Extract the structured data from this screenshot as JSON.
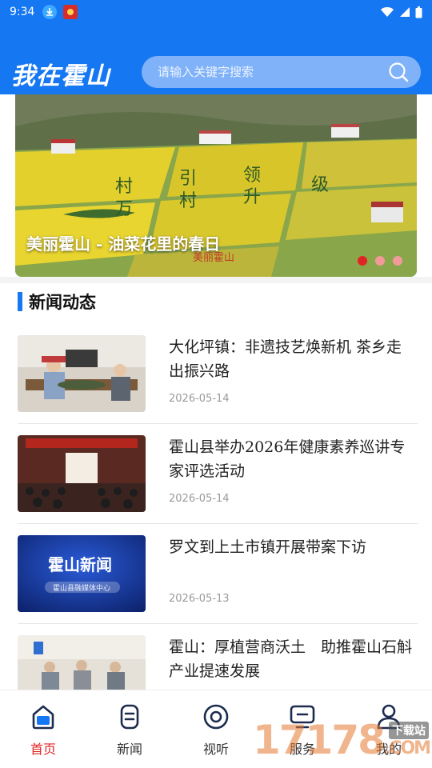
{
  "status_bar": {
    "time": "9:34",
    "icons": [
      "download-icon",
      "app-badge-icon",
      "wifi-icon",
      "signal-icon",
      "battery-icon"
    ]
  },
  "header": {
    "brand": "我在霍山",
    "search_placeholder": "请输入关键字搜索",
    "bg_color": "#1677f2"
  },
  "banner": {
    "caption": "美丽霍山 - 油菜花里的春日",
    "dots": 3,
    "active_dot": 0,
    "field_text": [
      "村",
      "引",
      "领",
      "村",
      "万",
      "升",
      "级"
    ],
    "watermark": "美丽霍山"
  },
  "section": {
    "title": "新闻动态"
  },
  "news": [
    {
      "title": "大化坪镇：非遗技艺焕新机 茶乡走出振兴路",
      "date": "2026-05-14",
      "thumb": "tea-workshop"
    },
    {
      "title": "霍山县举办2026年健康素养巡讲专家评选活动",
      "date": "2026-05-14",
      "thumb": "conference-hall"
    },
    {
      "title": "罗文到上土市镇开展带案下访",
      "date": "2026-05-13",
      "thumb": "news-logo",
      "thumb_text": "霍山新闻",
      "thumb_sub": "霍山县融媒体中心"
    },
    {
      "title": "霍山：厚植营商沃土　助推霍山石斛产业提速发展",
      "date": "",
      "thumb": "factory-workers"
    }
  ],
  "bottom_nav": [
    {
      "label": "首页",
      "icon": "home-icon",
      "active": true
    },
    {
      "label": "新闻",
      "icon": "news-icon",
      "active": false
    },
    {
      "label": "视听",
      "icon": "video-icon",
      "active": false
    },
    {
      "label": "服务",
      "icon": "service-icon",
      "active": false
    },
    {
      "label": "我的",
      "icon": "profile-icon",
      "active": false
    }
  ],
  "watermark": {
    "text": "17178",
    "sub": "下载站",
    "suffix": ".COM"
  }
}
